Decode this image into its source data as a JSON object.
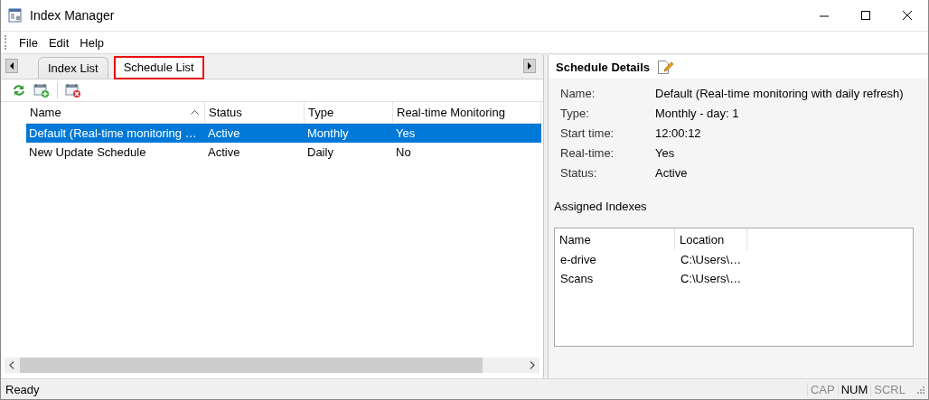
{
  "window": {
    "title": "Index Manager"
  },
  "menu": [
    {
      "label": "File"
    },
    {
      "label": "Edit"
    },
    {
      "label": "Help"
    }
  ],
  "tabs": [
    {
      "label": "Index List",
      "selected": false
    },
    {
      "label": "Schedule List",
      "selected": true
    }
  ],
  "schedule_list": {
    "columns": [
      {
        "label": "Name",
        "sorted": true
      },
      {
        "label": "Status",
        "sorted": false
      },
      {
        "label": "Type",
        "sorted": false
      },
      {
        "label": "Real-time Monitoring",
        "sorted": false
      }
    ],
    "rows": [
      {
        "cells": [
          "Default (Real-time monitoring …",
          "Active",
          "Monthly",
          "Yes"
        ],
        "selected": true
      },
      {
        "cells": [
          "New Update Schedule",
          "Active",
          "Daily",
          "No"
        ],
        "selected": false
      }
    ]
  },
  "details": {
    "title": "Schedule Details",
    "fields": [
      {
        "label": "Name:",
        "value": "Default (Real-time monitoring with daily refresh)"
      },
      {
        "label": "Type:",
        "value": "Monthly - day: 1"
      },
      {
        "label": "Start time:",
        "value": "12:00:12"
      },
      {
        "label": "Real-time:",
        "value": "Yes"
      },
      {
        "label": "Status:",
        "value": "Active"
      }
    ]
  },
  "assigned_indexes": {
    "title": "Assigned Indexes",
    "columns": [
      "Name",
      "Location"
    ],
    "rows": [
      [
        "e-drive",
        "C:\\Users\\…"
      ],
      [
        "Scans",
        "C:\\Users\\…"
      ]
    ]
  },
  "status_bar": {
    "text": "Ready",
    "indicators": [
      {
        "label": "CAP",
        "on": false
      },
      {
        "label": "NUM",
        "on": true
      },
      {
        "label": "SCRL",
        "on": false
      }
    ]
  }
}
